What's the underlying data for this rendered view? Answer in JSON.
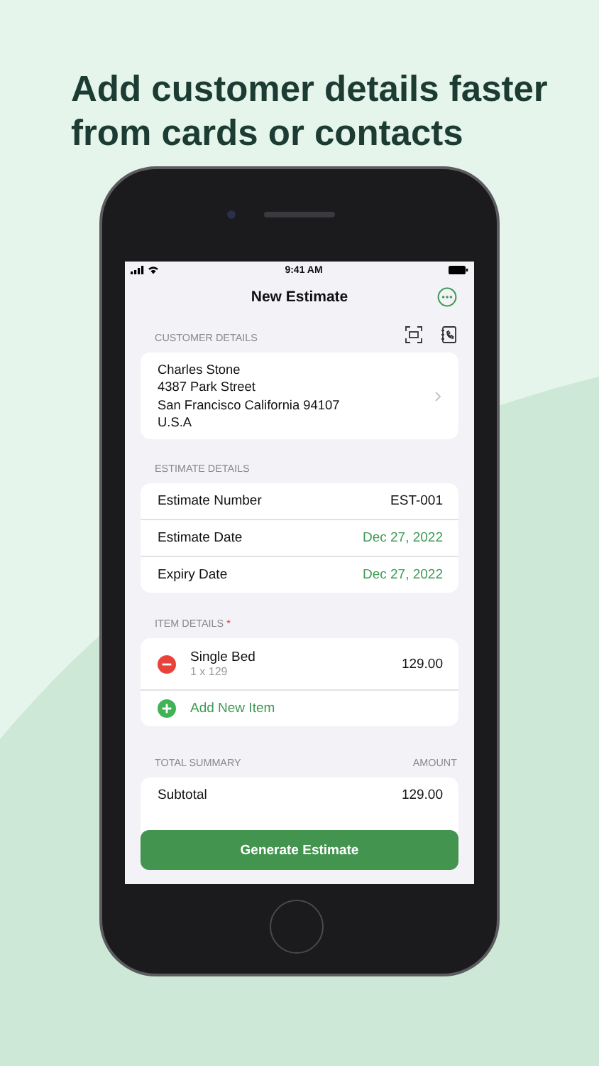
{
  "headline": "Add customer details faster from cards or contacts",
  "status_bar": {
    "time": "9:41 AM"
  },
  "nav": {
    "title": "New Estimate"
  },
  "customer_details": {
    "header": "CUSTOMER DETAILS",
    "lines": [
      "Charles Stone",
      "4387 Park Street",
      "San Francisco California 94107",
      "U.S.A"
    ]
  },
  "estimate_details": {
    "header": "ESTIMATE DETAILS",
    "rows": [
      {
        "label": "Estimate Number",
        "value": "EST-001",
        "kind": "text"
      },
      {
        "label": "Estimate Date",
        "value": "Dec 27, 2022",
        "kind": "date"
      },
      {
        "label": "Expiry Date",
        "value": "Dec 27, 2022",
        "kind": "date"
      }
    ]
  },
  "item_details": {
    "header": "ITEM DETAILS",
    "required_mark": "*",
    "items": [
      {
        "kind": "item",
        "name": "Single Bed",
        "detail": "1 x 129",
        "amount": "129.00"
      },
      {
        "kind": "add",
        "name": "Add New Item"
      }
    ]
  },
  "total_summary": {
    "header": "TOTAL SUMMARY",
    "column_header": "AMOUNT",
    "rows": [
      {
        "label": "Subtotal",
        "value": "129.00"
      }
    ]
  },
  "primary_button": "Generate Estimate"
}
